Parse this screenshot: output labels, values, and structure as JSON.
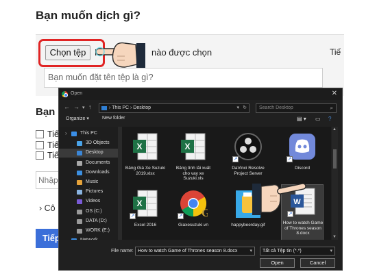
{
  "page": {
    "title": "Bạn muốn dịch gì?",
    "choose_file_button": "Chọn tệp",
    "no_file_prefix": "K",
    "no_file_suffix": "nào được chọn",
    "right_cut_text": "Tiế",
    "name_placeholder": "Bạn muốn đặt tên tệp là gì?",
    "section_label": "Bạn",
    "checkbox_labels": [
      "Tiế",
      "Tiế",
      "Tiế"
    ],
    "enter_placeholder": "Nhập",
    "advanced_label": "› Cô",
    "translate_button": "Tiếp"
  },
  "dialog": {
    "title": "Open",
    "breadcrumb": [
      "This PC",
      "Desktop"
    ],
    "search_placeholder": "Search Desktop",
    "toolbar": {
      "organize": "Organize ▾",
      "new_folder": "New folder"
    },
    "nav_items": [
      {
        "label": "This PC",
        "icon": "computer-icon",
        "color": "#3a8ee6"
      },
      {
        "label": "3D Objects",
        "icon": "cube-icon",
        "color": "#4aa3e8"
      },
      {
        "label": "Desktop",
        "icon": "desktop-icon",
        "color": "#3b86d6"
      },
      {
        "label": "Documents",
        "icon": "documents-icon",
        "color": "#a9a9a9"
      },
      {
        "label": "Downloads",
        "icon": "download-icon",
        "color": "#3c8fe0"
      },
      {
        "label": "Music",
        "icon": "music-icon",
        "color": "#e6a33a"
      },
      {
        "label": "Pictures",
        "icon": "pictures-icon",
        "color": "#8ab4e0"
      },
      {
        "label": "Videos",
        "icon": "videos-icon",
        "color": "#7a5bd6"
      },
      {
        "label": "OS (C:)",
        "icon": "drive-icon",
        "color": "#9a9a9a"
      },
      {
        "label": "DATA (D:)",
        "icon": "drive-icon",
        "color": "#9a9a9a"
      },
      {
        "label": "WORK (E:)",
        "icon": "drive-icon",
        "color": "#9a9a9a"
      },
      {
        "label": "Network",
        "icon": "network-icon",
        "color": "#3a8ee6"
      }
    ],
    "files": [
      {
        "label": "Bảng Giá Xe Suzuki 2019.xlsx",
        "icon": "excel-icon"
      },
      {
        "label": "Bảng tính lãi xuất cho vay xe Suzuki.xls",
        "icon": "excel-icon"
      },
      {
        "label": "DaVinci Resolve Project Server",
        "icon": "davinci-icon"
      },
      {
        "label": "Discord",
        "icon": "discord-icon"
      },
      {
        "label": "Excel 2016",
        "icon": "excel-icon"
      },
      {
        "label": "Giaxesuzuki.vn",
        "icon": "chrome-icon"
      },
      {
        "label": "happybeerday.gif",
        "icon": "image-icon"
      },
      {
        "label": "How to watch Game of Thrones season 8.docx",
        "icon": "word-icon"
      }
    ],
    "file_name_label": "File name:",
    "file_name_value": "How to watch Game of Thrones season 8.docx",
    "file_type_value": "Tất cả Tệp tin (*.*)",
    "open_button": "Open",
    "cancel_button": "Cancel"
  },
  "colors": {
    "highlight": "#e02424",
    "primary_button": "#3b6fd9",
    "dialog_bg": "#202020",
    "selected_tile": "#3b3b3b"
  }
}
